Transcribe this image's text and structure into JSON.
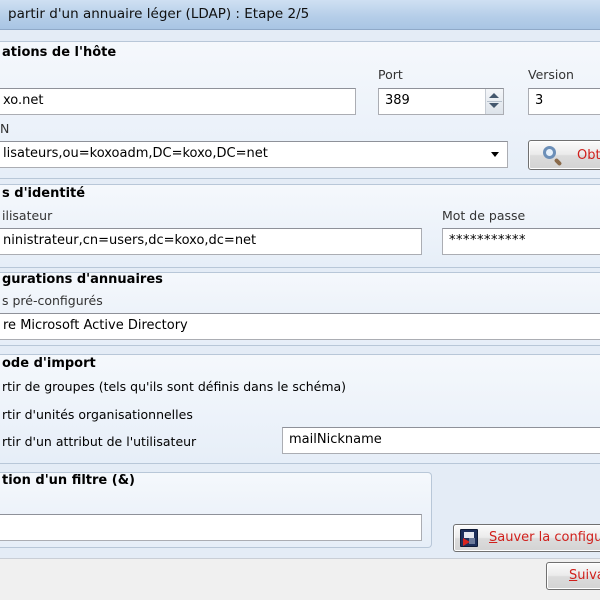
{
  "window": {
    "title": "partir d'un annuaire léger (LDAP) : Etape 2/5"
  },
  "host": {
    "section_title": "ations de l'hôte",
    "server_value": "xo.net",
    "port_label": "Port",
    "port_value": "389",
    "version_label": "Version",
    "version_value": "3",
    "dn_label": "N",
    "dn_value": "lisateurs,ou=koxoadm,DC=koxo,DC=net",
    "obtain_button_label": "Obt"
  },
  "identity": {
    "section_title": "s d'identité",
    "user_label": "ilisateur",
    "user_value": "ninistrateur,cn=users,dc=koxo,dc=net",
    "password_label": "Mot de passe",
    "password_value": "***********"
  },
  "directories": {
    "section_title": "gurations d'annuaires",
    "preconfigured_label": "s pré-configurés",
    "selected_value": "re Microsoft Active Directory"
  },
  "import_mode": {
    "section_title": "ode d'import",
    "option_groups": "rtir de groupes  (tels qu'ils sont définis dans le schéma)",
    "option_org_units": "rtir d'unités organisationnelles",
    "option_attribute": "rtir d'un attribut de l'utilisateur",
    "attribute_value": "mailNickname"
  },
  "filter": {
    "section_title": "tion d'un filtre (&)",
    "filter_value": ""
  },
  "save_button": {
    "label_underlined": "S",
    "label_rest": "auver la configu"
  },
  "next_button": {
    "label_underlined": "S",
    "label_rest": "uiva"
  },
  "colors": {
    "accent_red": "#d0201c",
    "group_border": "#b8c7d8",
    "window_bg": "#e4ecf6"
  }
}
